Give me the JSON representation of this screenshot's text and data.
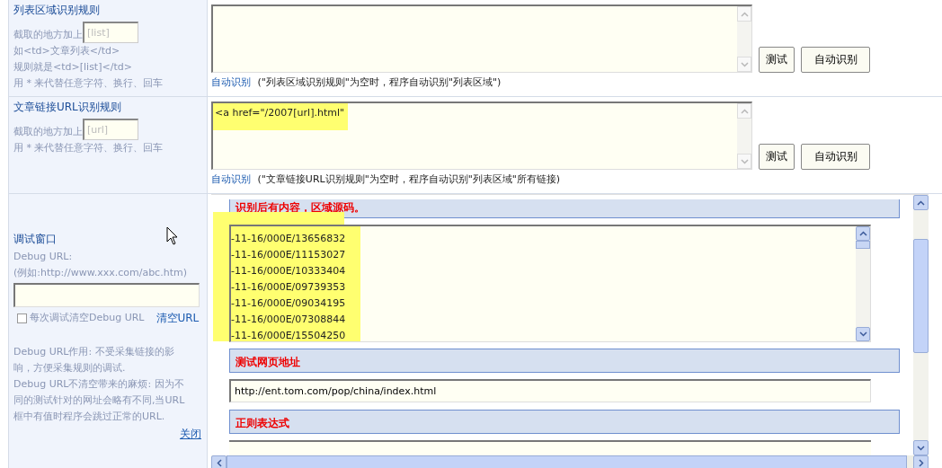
{
  "rules": [
    {
      "title": "列表区域识别规则",
      "hint_label": "截取的地方加上",
      "hint_placeholder": "[list]",
      "notes": [
        "如<td>文章列表</td>",
        "规则就是<td>[list]</td>",
        "用 * 来代替任意字符、换行、回车"
      ],
      "highlighted": false,
      "buttons": [
        "测试",
        "自动识别"
      ],
      "link": "自动识别",
      "note": "(\"列表区域识别规则\"为空时，程序自动识别\"列表区域\")"
    },
    {
      "title": "文章链接URL识别规则",
      "hint_label": "截取的地方加上",
      "hint_placeholder": "[url]",
      "notes": [
        "用 * 来代替任意字符、换行、回车"
      ],
      "value": "<a href=\"/2007[url].html\"",
      "highlighted": true,
      "buttons": [
        "测试",
        "自动识别"
      ],
      "link": "自动识别",
      "note": "(\"文章链接URL识别规则\"为空时，程序自动识别\"列表区域\"所有链接)"
    }
  ],
  "debug": {
    "title": "调试窗口",
    "label_lines": [
      "Debug URL:",
      "(例如:http://www.xxx.com/abc.htm)"
    ],
    "checkbox": {
      "label": "每次调试清空Debug URL",
      "checked": false
    },
    "clear_link": "清空URL",
    "help": [
      "Debug URL作用: 不受采集链接的影响，方便采集规则的调试.",
      "Debug URL不清空带来的麻烦: 因为不同的测试针对的网址会略有不同,当URL框中有值时程序会跳过正常的URL."
    ],
    "close_link": "关闭"
  },
  "preview": {
    "sections": [
      {
        "heading": "识别后有内容，区域源码。",
        "kind": "textarea",
        "highlighted": true,
        "lines": [
          "-11-16/000E/13656832",
          "-11-16/000E/11153027",
          "-11-16/000E/10333404",
          "-11-16/000E/09739353",
          "-11-16/000E/09034195",
          "-11-16/000E/07308844",
          "-11-16/000E/15504250"
        ]
      },
      {
        "heading": "测试网页地址",
        "kind": "input",
        "highlighted": false,
        "value": "http://ent.tom.com/pop/china/index.html"
      },
      {
        "heading": "正则表达式",
        "kind": "cutoff",
        "highlighted": false
      }
    ]
  }
}
